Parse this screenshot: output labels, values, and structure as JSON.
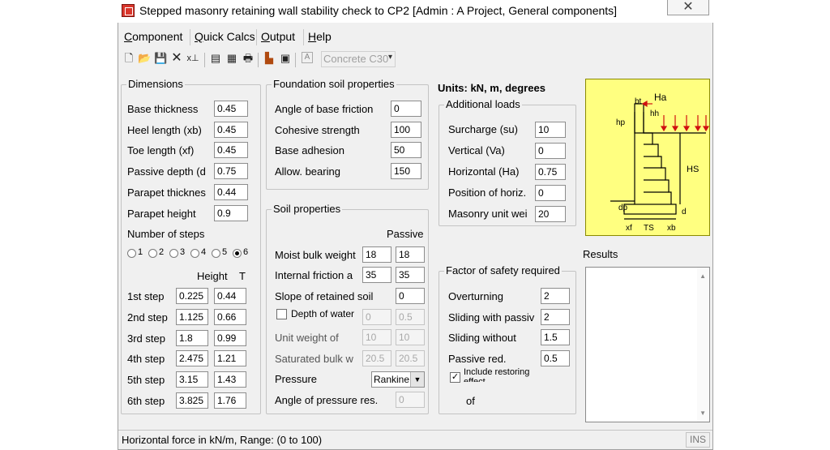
{
  "window": {
    "title": "Stepped masonry retaining wall stability check to CP2 [Admin : A Project, General components]",
    "close_glyph": "✕"
  },
  "menu": {
    "items": [
      {
        "pre": "",
        "u": "C",
        "post": "omponent"
      },
      {
        "pre": "",
        "u": "Q",
        "post": "uick Calcs"
      },
      {
        "pre": "",
        "u": "O",
        "post": "utput"
      },
      {
        "pre": "",
        "u": "H",
        "post": "elp"
      }
    ]
  },
  "toolbar": {
    "icons": [
      "new-file-icon",
      "open-folder-icon",
      "save-icon",
      "delete-icon",
      "split-icon",
      "preview-icon",
      "report-icon",
      "print-icon",
      "tool-icon",
      "comment-icon",
      "text-icon"
    ],
    "material": "Concrete C30"
  },
  "dimensions": {
    "title": "Dimensions",
    "fields": [
      {
        "label": "Base thickness",
        "value": "0.45"
      },
      {
        "label": "Heel length (xb)",
        "value": "0.45"
      },
      {
        "label": "Toe length (xf)",
        "value": "0.45"
      },
      {
        "label": "Passive depth (d",
        "value": "0.75"
      },
      {
        "label": "Parapet thicknes",
        "value": "0.44"
      },
      {
        "label": "Parapet height",
        "value": "0.9"
      }
    ],
    "steps_label": "Number of steps",
    "step_options": [
      "1",
      "2",
      "3",
      "4",
      "5",
      "6"
    ],
    "selected_steps": "6",
    "height_header": "Height",
    "t_header": "T",
    "steps": [
      {
        "label": "1st step",
        "height": "0.225",
        "t": "0.44"
      },
      {
        "label": "2nd step",
        "height": "1.125",
        "t": "0.66"
      },
      {
        "label": "3rd step",
        "height": "1.8",
        "t": "0.99"
      },
      {
        "label": "4th step",
        "height": "2.475",
        "t": "1.21"
      },
      {
        "label": "5th step",
        "height": "3.15",
        "t": "1.43"
      },
      {
        "label": "6th step",
        "height": "3.825",
        "t": "1.76"
      }
    ]
  },
  "foundation": {
    "title": "Foundation soil properties",
    "fields": [
      {
        "label": "Angle of base friction",
        "value": "0"
      },
      {
        "label": "Cohesive strength",
        "value": "100"
      },
      {
        "label": "Base adhesion",
        "value": "50"
      },
      {
        "label": "Allow. bearing",
        "value": "150"
      }
    ]
  },
  "soil": {
    "title": "Soil properties",
    "passive_header": "Passive",
    "moist_label": "Moist bulk weight",
    "moist": "18",
    "moist_p": "18",
    "friction_label": "Internal friction a",
    "friction": "35",
    "friction_p": "35",
    "slope_label": "Slope of retained soil",
    "slope": "0",
    "water_label": "Depth of water",
    "water": "0",
    "water_p": "0.5",
    "unit_weight_label": "Unit weight of",
    "unit_weight": "10",
    "unit_weight_p": "10",
    "saturated_label": "Saturated bulk w",
    "saturated": "20.5",
    "saturated_p": "20.5",
    "pressure_label": "Pressure",
    "pressure": "Rankine",
    "angle_label": "Angle of pressure res.",
    "angle": "0"
  },
  "units_label": "Units: kN, m, degrees",
  "loads": {
    "title": "Additional loads",
    "fields": [
      {
        "label": "Surcharge (su)",
        "value": "10"
      },
      {
        "label": "Vertical (Va)",
        "value": "0"
      },
      {
        "label": "Horizontal (Ha)",
        "value": "0.75"
      },
      {
        "label": "Position of horiz.",
        "value": "0"
      },
      {
        "label": "Masonry unit wei",
        "value": "20"
      }
    ]
  },
  "safety": {
    "title": "Factor of safety required",
    "fields": [
      {
        "label": "Overturning",
        "value": "2"
      },
      {
        "label": "Sliding with passiv",
        "value": "2"
      },
      {
        "label": "Sliding without",
        "value": "1.5"
      },
      {
        "label": "Passive red.",
        "value": "0.5"
      }
    ],
    "restoring_label": "Include restoring effect",
    "of_label": "of"
  },
  "diagram": {
    "labels": {
      "ha": "Ha",
      "bt": "bt",
      "hh": "hh",
      "hp": "hp",
      "hs": "HS",
      "dp": "dp",
      "d": "d",
      "xf": "xf",
      "ts": "TS",
      "xb": "xb"
    }
  },
  "results": {
    "label": "Results"
  },
  "status": {
    "text": "Horizontal force in kN/m, Range: (0 to 100)",
    "ins": "INS"
  }
}
